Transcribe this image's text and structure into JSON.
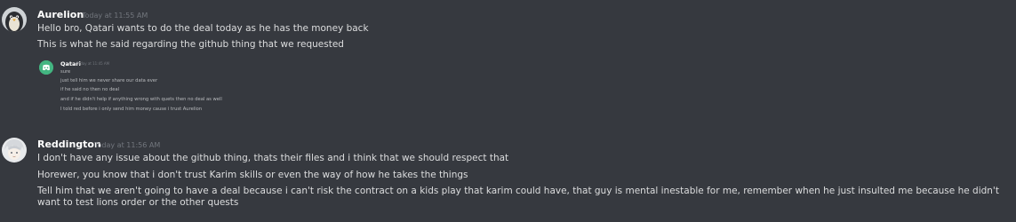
{
  "messages": [
    {
      "username": "Aurelion",
      "timestamp": "Today at 11:55 AM",
      "avatar_icon": "penguin-avatar-icon",
      "lines": [
        "Hello bro, Qatari wants to do the deal today as he has the money back",
        "This is what he said regarding the github thing that we requested"
      ],
      "embed": {
        "avatar_icon": "discord-logo-icon",
        "username": "Qatari",
        "timestamp": "Today at 11:45 AM",
        "lines": [
          "sure",
          "just tell him we never share our data ever",
          "if he said no then no deal",
          "and if he didn't help if anything wrong with quets then no deal as well",
          "I told red before i only send him money cause i trust Aurelion"
        ]
      }
    },
    {
      "username": "Reddington",
      "timestamp": "Today at 11:56 AM",
      "avatar_icon": "anime-avatar-icon",
      "lines": [
        "I don't have any issue about the github thing, thats their files and i think that we should respect that",
        "Horewer, you know that i don't trust Karim skills or even the way of how he takes the things",
        "Tell him that we aren't going to have a deal because i can't risk the contract on a kids play that karim could have, that guy is mental inestable for me, remember when he just insulted me because he didn't want to test lions order or the other quests"
      ]
    }
  ],
  "colors": {
    "background": "#36393f",
    "username": "#ffffff",
    "text": "#dcddde",
    "timestamp": "#72767d",
    "discord_green": "#43b581"
  }
}
